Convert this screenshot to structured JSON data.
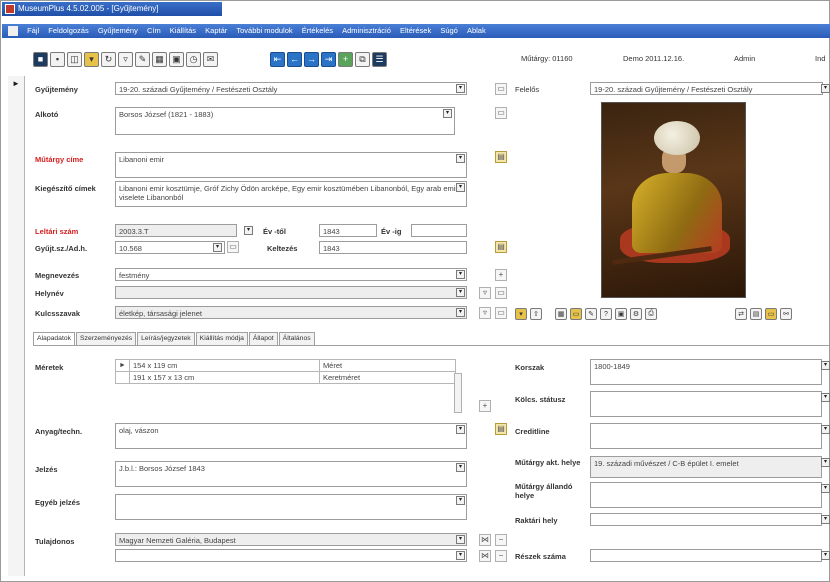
{
  "window": {
    "title": "MuseumPlus 4.5.02.005 - [Gyűjtemény]"
  },
  "menu": [
    "Fájl",
    "Feldolgozás",
    "Gyűjtemény",
    "Cím",
    "Kiállítás",
    "Kaptár",
    "További modulok",
    "Értékelés",
    "Adminisztráció",
    "Eltérések",
    "Súgó",
    "Ablak"
  ],
  "header": {
    "record_label": "Műtárgy: 01160",
    "date": "Demo 2011.12.16.",
    "user": "Admin",
    "extra": "Ind"
  },
  "fields": {
    "gyujtemeny": {
      "label": "Gyűjtemény",
      "value": "19-20. századi Gyűjtemény / Festészeti Osztály"
    },
    "alkoto": {
      "label": "Alkotó",
      "value": "Borsos József (1821 - 1883)"
    },
    "mutargy_cime": {
      "label": "Műtárgy címe",
      "value": "Libanoni emir"
    },
    "kiegeszito_cimek": {
      "label": "Kiegészítő címek",
      "value": "Libanoni emir kosztümje, Gróf Zichy Ödön arcképe, Egy emir kosztümében Libanonból, Egy arab emir viselete Libanonból"
    },
    "leltari_szam": {
      "label": "Leltári szám",
      "value": "2003.3.T"
    },
    "ev_tol": {
      "label": "Év -től",
      "value": "1843"
    },
    "ev_ig": {
      "label": "Év -ig",
      "value": ""
    },
    "gyujt_sz": {
      "label": "Gyűjt.sz./Ad.h.",
      "value": "10.568"
    },
    "keltezes": {
      "label": "Keltezés",
      "value": "1843"
    },
    "megnevezes": {
      "label": "Megnevezés",
      "value": "festmény"
    },
    "helynev": {
      "label": "Helynév",
      "value": ""
    },
    "kulcsszavak": {
      "label": "Kulcsszavak",
      "value": "életkép, társasági jelenet"
    },
    "felelos": {
      "label": "Felelős",
      "value": "19-20. századi Gyűjtemény / Festészeti Osztály"
    }
  },
  "tabs": [
    "Alapadatok",
    "Szerzeményezés",
    "Leírás/jegyzetek",
    "Kiállítás módja",
    "Állapot",
    "Általános"
  ],
  "meretek": {
    "label": "Méretek",
    "rows": [
      {
        "value": "154 x 119 cm",
        "type": "Méret"
      },
      {
        "value": "191 x 157 x 13 cm",
        "type": "Keretméret"
      }
    ]
  },
  "lower": {
    "anyag": {
      "label": "Anyag/techn.",
      "value": "olaj, vászon"
    },
    "jelzes": {
      "label": "Jelzés",
      "value": "J.b.l.: Borsos József 1843"
    },
    "egyeb_jelzes": {
      "label": "Egyéb jelzés",
      "value": ""
    },
    "tulajdonos": {
      "label": "Tulajdonos",
      "value": "Magyar Nemzeti Galéria, Budapest"
    },
    "korszak": {
      "label": "Korszak",
      "value": "1800-1849"
    },
    "kolcs_statusz": {
      "label": "Kölcs. státusz",
      "value": ""
    },
    "creditline": {
      "label": "Creditline",
      "value": ""
    },
    "mutargy_akt_helye": {
      "label": "Műtárgy akt. helye",
      "value": "19. századi művészet / C-B épület I. emelet"
    },
    "mutargy_allando_helye": {
      "label": "Műtárgy állandó helye",
      "value": ""
    },
    "raktari_hely": {
      "label": "Raktári hely",
      "value": ""
    },
    "reszek_szama": {
      "label": "Részek száma",
      "value": ""
    }
  }
}
